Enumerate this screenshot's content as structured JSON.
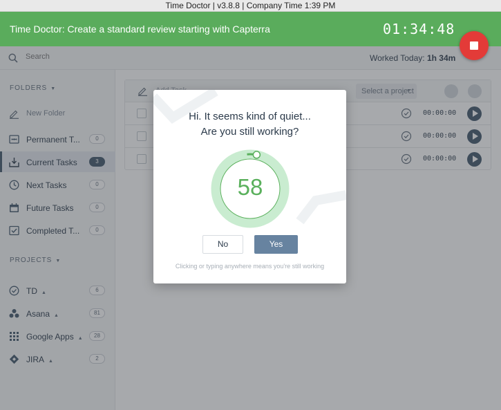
{
  "window": {
    "title": "Time Doctor | v3.8.8 | Company Time 1:39 PM"
  },
  "header": {
    "current_task": "Time Doctor: Create a standard review starting with Capterra",
    "timer": "01:34:48",
    "stop_icon": "stop-icon",
    "color": "#5aac5c"
  },
  "search": {
    "placeholder": "Search",
    "icon": "search-icon"
  },
  "worked_today": {
    "label": "Worked Today:",
    "value": "1h 34m"
  },
  "sidebar": {
    "folders_heading": "FOLDERS",
    "new_folder": "New Folder",
    "folders": [
      {
        "label": "Permanent T...",
        "count": "0",
        "icon": "infinity-icon"
      },
      {
        "label": "Current Tasks",
        "count": "3",
        "icon": "inbox-icon",
        "active": true
      },
      {
        "label": "Next Tasks",
        "count": "0",
        "icon": "clock-icon"
      },
      {
        "label": "Future Tasks",
        "count": "0",
        "icon": "calendar-icon"
      },
      {
        "label": "Completed T...",
        "count": "0",
        "icon": "check-box-icon"
      }
    ],
    "projects_heading": "PROJECTS",
    "projects": [
      {
        "label": "TD",
        "count": "6",
        "icon": "circle-check-icon"
      },
      {
        "label": "Asana",
        "count": "81",
        "icon": "asana-icon"
      },
      {
        "label": "Google Apps",
        "count": "28",
        "icon": "grid-icon"
      },
      {
        "label": "JIRA",
        "count": "2",
        "icon": "jira-icon"
      }
    ]
  },
  "tasks": {
    "add_placeholder": "Add Task",
    "project_select": "Select a project",
    "rows": [
      {
        "time": "00:00:00"
      },
      {
        "time": "00:00:00"
      },
      {
        "time": "00:00:00"
      }
    ]
  },
  "idle_dialog": {
    "line1": "Hi. It seems kind of quiet...",
    "line2": "Are you still working?",
    "countdown": "58",
    "countdown_progress": 0.97,
    "no_label": "No",
    "yes_label": "Yes",
    "hint": "Clicking or typing anywhere means you're still working",
    "accent": "#5ab05c"
  }
}
